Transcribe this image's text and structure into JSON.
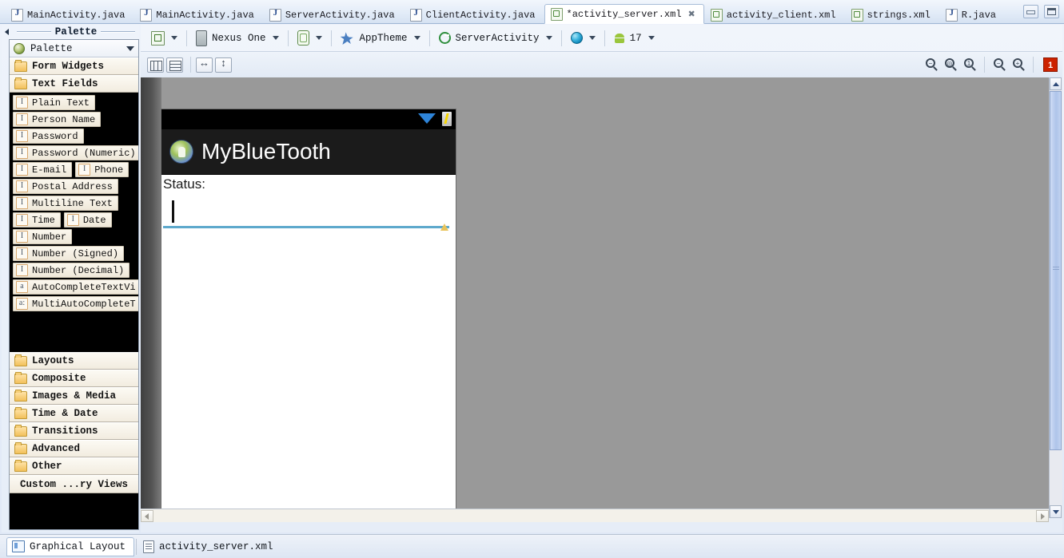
{
  "window": {
    "minimize_label": "",
    "maximize_label": ""
  },
  "editor_tabs": [
    {
      "label": "MainActivity.java",
      "icon": "java-file-icon",
      "active": false,
      "closable": false
    },
    {
      "label": "MainActivity.java",
      "icon": "java-file-icon",
      "active": false,
      "closable": false
    },
    {
      "label": "ServerActivity.java",
      "icon": "java-file-icon",
      "active": false,
      "closable": false
    },
    {
      "label": "ClientActivity.java",
      "icon": "java-file-icon",
      "active": false,
      "closable": false
    },
    {
      "label": "*activity_server.xml",
      "icon": "xml-file-icon",
      "active": true,
      "closable": true,
      "close_glyph": "✖"
    },
    {
      "label": "activity_client.xml",
      "icon": "xml-file-icon",
      "active": false,
      "closable": false
    },
    {
      "label": "strings.xml",
      "icon": "xml-file-icon",
      "active": false,
      "closable": false
    },
    {
      "label": "R.java",
      "icon": "java-file-icon",
      "active": false,
      "closable": false
    }
  ],
  "palette": {
    "view_title": "Palette",
    "combo_label": "Palette",
    "categories_top": [
      {
        "label": "Form Widgets",
        "icon": "folder-icon",
        "expanded": false
      },
      {
        "label": "Text Fields",
        "icon": "folder-open-icon",
        "expanded": true
      }
    ],
    "text_field_rows": [
      [
        {
          "label": "Plain Text",
          "badge": "I"
        }
      ],
      [
        {
          "label": "Person Name",
          "badge": "I"
        }
      ],
      [
        {
          "label": "Password",
          "badge": "I"
        }
      ],
      [
        {
          "label": "Password (Numeric)",
          "badge": "I"
        }
      ],
      [
        {
          "label": "E-mail",
          "badge": "I"
        },
        {
          "label": "Phone",
          "badge": "I"
        }
      ],
      [
        {
          "label": "Postal Address",
          "badge": "I"
        }
      ],
      [
        {
          "label": "Multiline Text",
          "badge": "I"
        }
      ],
      [
        {
          "label": "Time",
          "badge": "I"
        },
        {
          "label": "Date",
          "badge": "I"
        }
      ],
      [
        {
          "label": "Number",
          "badge": "I"
        }
      ],
      [
        {
          "label": "Number (Signed)",
          "badge": "I"
        }
      ],
      [
        {
          "label": "Number (Decimal)",
          "badge": "I"
        }
      ],
      [
        {
          "label": "AutoCompleteTextVi",
          "badge": "a"
        }
      ],
      [
        {
          "label": "MultiAutoCompleteT",
          "badge": "a:"
        }
      ]
    ],
    "categories_bottom": [
      {
        "label": "Layouts",
        "icon": "folder-icon"
      },
      {
        "label": "Composite",
        "icon": "folder-icon"
      },
      {
        "label": "Images & Media",
        "icon": "folder-icon"
      },
      {
        "label": "Time & Date",
        "icon": "folder-icon"
      },
      {
        "label": "Transitions",
        "icon": "folder-icon"
      },
      {
        "label": "Advanced",
        "icon": "folder-icon"
      },
      {
        "label": "Other",
        "icon": "folder-icon"
      }
    ],
    "custom_row_label": "Custom ...ry Views"
  },
  "toolbar": {
    "config_label": "",
    "device": "Nexus One",
    "orientation": "",
    "theme": "AppTheme",
    "activity": "ServerActivity",
    "locale": "",
    "api_level": "17"
  },
  "toolbar2": {
    "buttons": [
      {
        "name": "show-columns-button"
      },
      {
        "name": "show-rows-button"
      },
      {
        "name": "fit-width-button"
      },
      {
        "name": "fit-height-button"
      }
    ],
    "zoom_buttons": [
      {
        "name": "zoom-fit-button",
        "glyph": "−"
      },
      {
        "name": "zoom-fit-selection-button",
        "glyph": "⊙"
      },
      {
        "name": "zoom-actual-size-button",
        "glyph": "1"
      },
      {
        "name": "zoom-out-button",
        "glyph": "−"
      },
      {
        "name": "zoom-in-button",
        "glyph": "+"
      }
    ],
    "error_badge": "1"
  },
  "preview": {
    "app_title": "MyBlueTooth",
    "status_label": "Status:",
    "edit_text_value": "",
    "warning_marker": "layout-warning-icon",
    "status_bar_icons": [
      "wifi-icon",
      "battery-charging-icon"
    ]
  },
  "bottom_tabs": [
    {
      "label": "Graphical Layout",
      "icon": "graphical-layout-icon",
      "active": true
    },
    {
      "label": "activity_server.xml",
      "icon": "xml-source-icon",
      "active": false
    }
  ],
  "colors": {
    "canvas_background": "#999999",
    "device_title_bar": "#1b1b1b",
    "edit_text_underline": "#5ea9cc",
    "error_badge": "#cc2200",
    "active_tab_background": "#ffffff"
  }
}
